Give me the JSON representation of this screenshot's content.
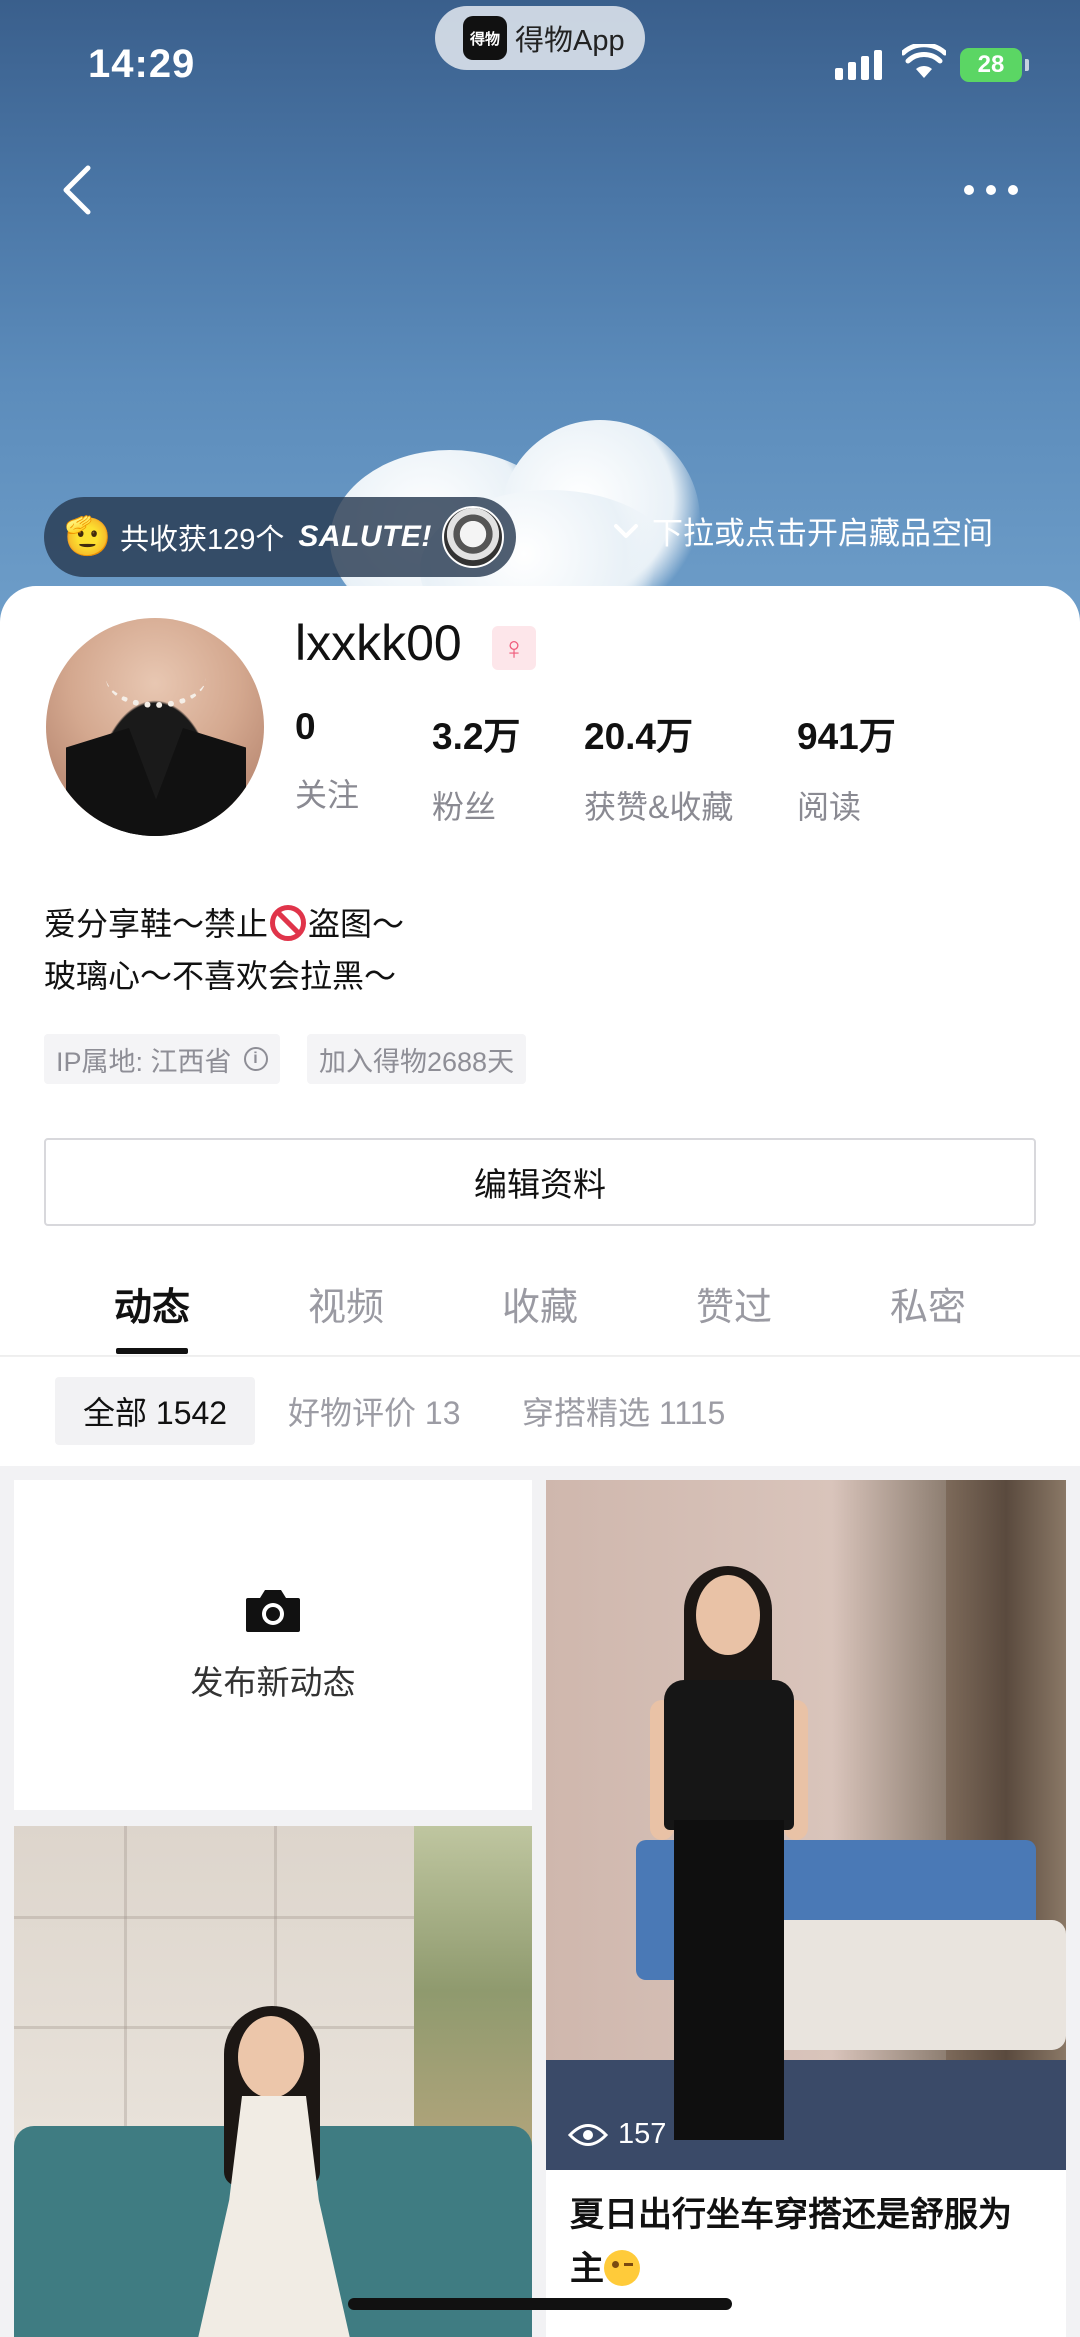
{
  "status_bar": {
    "time": "14:29",
    "app_pill": {
      "logo_text": "得物",
      "label": "得物App"
    },
    "battery": "28"
  },
  "header": {
    "salute": {
      "text": "共收获129个",
      "word": "SALUTE!"
    },
    "pull_hint": "下拉或点击开启藏品空间"
  },
  "profile": {
    "username": "lxxkk00",
    "gender_symbol": "♀",
    "stats": [
      {
        "value": "0",
        "label": "关注"
      },
      {
        "value": "3.2万",
        "label": "粉丝"
      },
      {
        "value": "20.4万",
        "label": "获赞&收藏"
      },
      {
        "value": "941万",
        "label": "阅读"
      }
    ],
    "bio_line1_a": "爱分享鞋～禁止",
    "bio_line1_b": "盗图～",
    "bio_line2": "玻璃心～不喜欢会拉黑～",
    "tags": {
      "ip": "IP属地: 江西省",
      "joined": "加入得物2688天"
    },
    "edit_button": "编辑资料"
  },
  "tabs": [
    "动态",
    "视频",
    "收藏",
    "赞过",
    "私密"
  ],
  "active_tab": "动态",
  "filters": [
    {
      "label": "全部 1542",
      "active": true
    },
    {
      "label": "好物评价 13",
      "active": false
    },
    {
      "label": "穿搭精选 1115",
      "active": false
    }
  ],
  "feed": {
    "post_new_label": "发布新动态",
    "right_post": {
      "views": "157",
      "caption": "夏日出行坐车穿搭还是舒服为主"
    }
  },
  "icons": {
    "back": "chevron-left-icon",
    "more": "more-dots-icon",
    "camera": "camera-icon",
    "eye": "eye-icon",
    "info": "info-icon",
    "chevron_down": "chevron-down-icon"
  },
  "colors": {
    "accent_text": "#111111",
    "muted_text": "#8a8a92",
    "gender_pink": "#ef5b7b",
    "battery_green": "#5bd664"
  }
}
